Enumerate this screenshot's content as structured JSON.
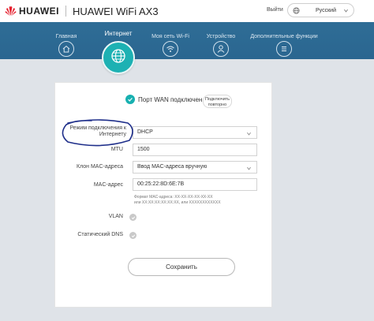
{
  "header": {
    "brand": "HUAWEI",
    "product": "HUAWEI WiFi AX3",
    "exit": "Выйти",
    "language": "Русский"
  },
  "nav": {
    "items": [
      {
        "label": "Главная",
        "icon": "home-icon"
      },
      {
        "label": "Интернет",
        "icon": "globe-icon"
      },
      {
        "label": "Моя сеть Wi-Fi",
        "icon": "wifi-icon"
      },
      {
        "label": "Устройство",
        "icon": "user-icon"
      },
      {
        "label": "Дополнительные функции",
        "icon": "menu-icon"
      }
    ],
    "active_index": 1
  },
  "status": {
    "text": "Порт WAN подключен",
    "reconnect_label": "Подключить повторно"
  },
  "form": {
    "mode_label": "Режим подключения к Интернету",
    "mode_value": "DHCP",
    "mtu_label": "MTU",
    "mtu_value": "1500",
    "clone_label": "Клон MAC-адреса",
    "clone_value": "Ввод MAC-адреса вручную",
    "mac_label": "MAC-адрес",
    "mac_value": "00:25:22:8D:6E:7B",
    "mac_hint_line1": "Формат MAC-адреса: XX-XX-XX-XX-XX-XX",
    "mac_hint_line2": "или XX:XX:XX:XX:XX:XX, или XXXXXXXXXXXX",
    "vlan_label": "VLAN",
    "static_dns_label": "Статический DNS",
    "save_label": "Сохранить"
  },
  "colors": {
    "nav_bg": "#2c6a93",
    "accent": "#1db1b3",
    "annotation": "#1f2f8a",
    "brand_red": "#e5202e"
  }
}
